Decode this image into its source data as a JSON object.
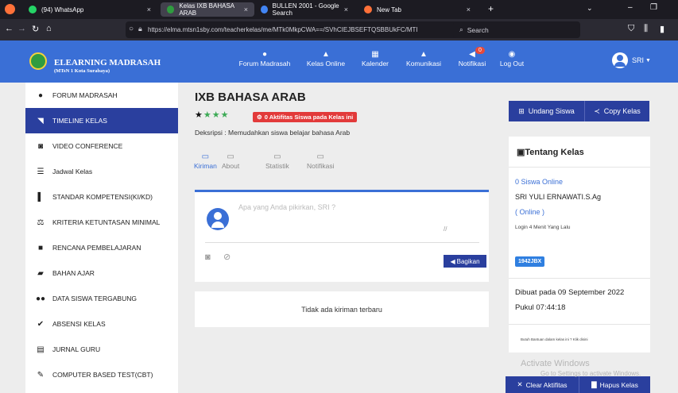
{
  "browser": {
    "tabs": [
      {
        "label": "(94) WhatsApp",
        "favicon_color": "#25d366"
      },
      {
        "label": "Kelas IXB BAHASA ARAB",
        "favicon_color": "#2f9c3f"
      },
      {
        "label": "BULLEN 2001 - Google Search",
        "favicon_color": "#4285f4"
      },
      {
        "label": "New Tab",
        "favicon_color": "#ff7139"
      }
    ],
    "new_tab": "+",
    "close": "×",
    "url": "https://elma.mtsn1sby.com/teacherkelas/me/MTk0MkpCWA==/SVhCIEJBSEFTQSBBUkFC/MTI",
    "url_domain": "mtsn1sby.com",
    "search_placeholder": "Search"
  },
  "header": {
    "brand": "ELEARNING MADRASAH",
    "brand_sub": "(MTsN 1 Kota Surabaya)",
    "nav": [
      {
        "label": "Forum Madrasah",
        "icon": "chat-icon"
      },
      {
        "label": "Kelas Online",
        "icon": "graduation-cap-icon"
      },
      {
        "label": "Kalender",
        "icon": "calendar-icon"
      },
      {
        "label": "Komunikasi",
        "icon": "bell-icon"
      },
      {
        "label": "Notifikasi",
        "icon": "megaphone-icon"
      },
      {
        "label": "Log Out",
        "icon": "power-icon"
      }
    ],
    "notif_count": "0",
    "user": "SRI"
  },
  "sidebar": {
    "items": [
      {
        "label": "FORUM MADRASAH",
        "icon": "comments-icon"
      },
      {
        "label": "TIMELINE KELAS",
        "icon": "rss-icon"
      },
      {
        "label": "VIDEO CONFERENCE",
        "icon": "camera-icon"
      },
      {
        "label": "Jadwal Kelas",
        "icon": "list-icon"
      },
      {
        "label": "STANDAR KOMPETENSI(KI/KD)",
        "icon": "book-icon"
      },
      {
        "label": "KRITERIA KETUNTASAN MINIMAL",
        "icon": "balance-icon"
      },
      {
        "label": "RENCANA PEMBELAJARAN",
        "icon": "briefcase-icon"
      },
      {
        "label": "BAHAN AJAR",
        "icon": "folder-icon"
      },
      {
        "label": "DATA SISWA TERGABUNG",
        "icon": "users-icon"
      },
      {
        "label": "ABSENSI KELAS",
        "icon": "check-icon"
      },
      {
        "label": "JURNAL GURU",
        "icon": "bed-icon"
      },
      {
        "label": "COMPUTER BASED TEST(CBT)",
        "icon": "edit-icon"
      }
    ],
    "active_index": 1
  },
  "main": {
    "title": "IXB BAHASA ARAB",
    "rating": {
      "stars_filled": 4,
      "stars_total": 4
    },
    "activity_badge": "0 Aktifitas Siswa pada Kelas ini",
    "description": "Deksripsi : Memudahkan siswa belajar bahasa Arab",
    "tabs": [
      "Kiriman",
      "About",
      "Statistik",
      "Notifikasi"
    ],
    "post_placeholder": "Apa yang Anda pikirkan, SRI  ?",
    "share_label": "Bagikan",
    "empty_label": "Tidak ada kiriman terbaru"
  },
  "right": {
    "invite_label": "Undang Siswa",
    "copy_label": "Copy Kelas",
    "about_title": "Tentang Kelas",
    "online_count": "0 Siswa Online",
    "teacher_name": "SRI YULI ERNAWATI.S.Ag",
    "teacher_status": "( Online )",
    "last_login": "Login 4 Menit Yang Lalu",
    "class_code": "1942JBX",
    "created": "Dibuat pada 09 September 2022",
    "created_time": "Pukul 07:44:18",
    "help": "Butuh Bantuan dalam kelas ini ? Klik disini",
    "clear_label": "Clear Aktifitas",
    "delete_label": "Hapus Kelas"
  },
  "watermark": {
    "title": "Activate Windows",
    "sub": "Go to Settings to activate Windows."
  },
  "colors": {
    "header": "#3a6fd6",
    "primary": "#2a3f9e",
    "danger": "#e23a3a",
    "link": "#3a6fd6"
  }
}
